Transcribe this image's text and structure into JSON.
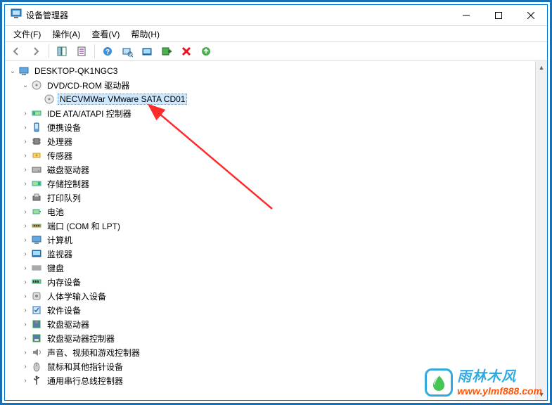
{
  "window": {
    "title": "设备管理器"
  },
  "menu": {
    "file": "文件(F)",
    "action": "操作(A)",
    "view": "查看(V)",
    "help": "帮助(H)"
  },
  "toolbar_icons": {
    "back": "back",
    "forward": "forward",
    "prop": "properties",
    "help": "help",
    "scan": "scan",
    "monitor": "monitor",
    "add": "add-hw",
    "remove": "remove",
    "update": "update"
  },
  "tree": {
    "root": "DESKTOP-QK1NGC3",
    "nodes": [
      {
        "label": "DVD/CD-ROM 驱动器",
        "expanded": true,
        "icon": "cdrom",
        "children": [
          {
            "label": "NECVMWar VMware SATA CD01",
            "icon": "cdrom",
            "selected": true
          }
        ]
      },
      {
        "label": "IDE ATA/ATAPI 控制器",
        "icon": "ide"
      },
      {
        "label": "便携设备",
        "icon": "portable"
      },
      {
        "label": "处理器",
        "icon": "cpu"
      },
      {
        "label": "传感器",
        "icon": "sensor"
      },
      {
        "label": "磁盘驱动器",
        "icon": "disk"
      },
      {
        "label": "存储控制器",
        "icon": "storage"
      },
      {
        "label": "打印队列",
        "icon": "printer"
      },
      {
        "label": "电池",
        "icon": "battery"
      },
      {
        "label": "端口 (COM 和 LPT)",
        "icon": "port"
      },
      {
        "label": "计算机",
        "icon": "computer"
      },
      {
        "label": "监视器",
        "icon": "monitor"
      },
      {
        "label": "键盘",
        "icon": "keyboard"
      },
      {
        "label": "内存设备",
        "icon": "memory"
      },
      {
        "label": "人体学输入设备",
        "icon": "hid"
      },
      {
        "label": "软件设备",
        "icon": "software"
      },
      {
        "label": "软盘驱动器",
        "icon": "floppy"
      },
      {
        "label": "软盘驱动器控制器",
        "icon": "floppyctrl"
      },
      {
        "label": "声音、视频和游戏控制器",
        "icon": "sound"
      },
      {
        "label": "鼠标和其他指针设备",
        "icon": "mouse"
      },
      {
        "label": "通用串行总线控制器",
        "icon": "usb"
      }
    ]
  },
  "watermark": {
    "cn": "雨林木风",
    "url": "www.ylmf888.com"
  },
  "colors": {
    "accent": "#0078d7",
    "selection": "#cde8ff",
    "arrow": "#ff2a2a",
    "wm_blue": "#2aa7df",
    "wm_orange": "#ff4d00"
  }
}
